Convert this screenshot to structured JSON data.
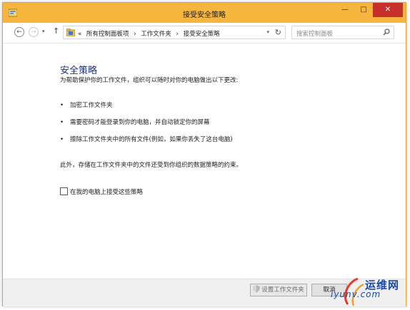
{
  "window": {
    "title": "接受安全策略",
    "min_label": "—",
    "max_label": "□",
    "close_label": "✕"
  },
  "nav": {
    "back_glyph": "←",
    "forward_glyph": "→",
    "dropdown_glyph": "▾",
    "up_glyph": "↑",
    "breadcrumb": [
      {
        "label": "«"
      },
      {
        "label": "所有控制面板项"
      },
      {
        "sep": "›"
      },
      {
        "label": "工作文件夹"
      },
      {
        "sep": "›"
      },
      {
        "label": "接受安全策略"
      }
    ],
    "refresh_glyph": "↻",
    "search_placeholder": "搜索控制面板"
  },
  "content": {
    "heading": "安全策略",
    "intro": "为帮助保护你的工作文件，组织可以随时对你的电脑做出以下更改:",
    "bullets": [
      "加密工作文件夹",
      "需要密码才能登录到你的电脑，并自动锁定你的屏幕",
      "擦除工作文件夹中的所有文件(例如，如果你丢失了这台电脑)"
    ],
    "note": "此外，存储在工作文件夹中的文件还受到你组织的数据策略的约束。",
    "accept_label": "在我的电脑上接受这些策略",
    "accept_checked": false
  },
  "footer": {
    "setup_button": "设置工作文件夹",
    "cancel_button": "取消"
  },
  "watermark": {
    "text": "运维网",
    "url": "iyunv.com"
  },
  "colors": {
    "titlebar": "#f6b53c",
    "heading": "#1e3287",
    "close": "#c7302a"
  }
}
